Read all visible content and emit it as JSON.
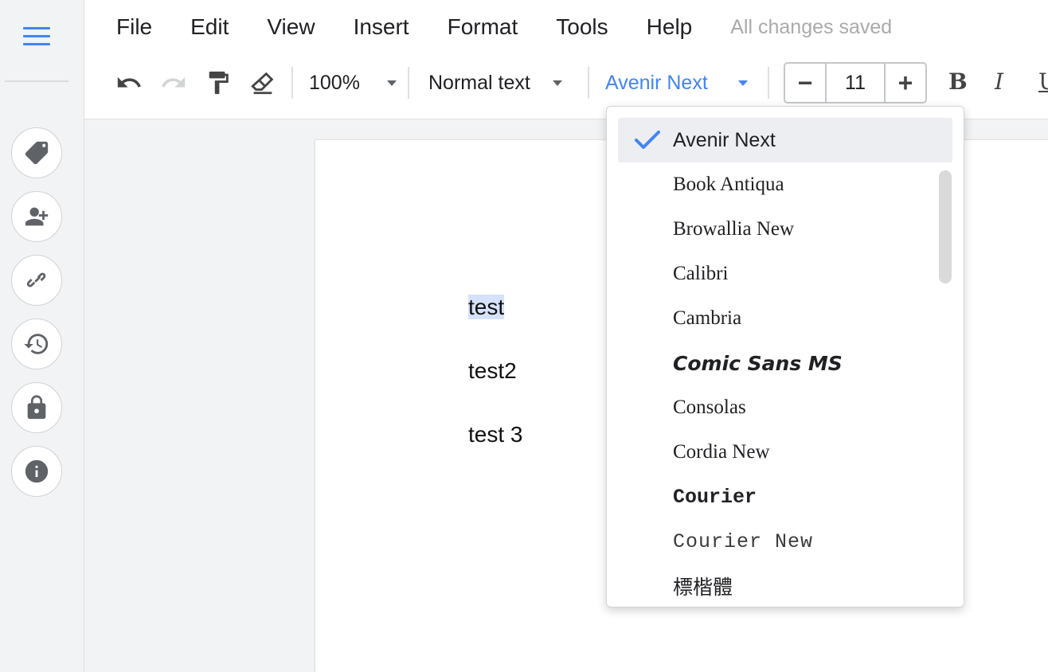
{
  "menubar": {
    "items": [
      "File",
      "Edit",
      "View",
      "Insert",
      "Format",
      "Tools",
      "Help"
    ],
    "status": "All changes saved"
  },
  "toolbar": {
    "zoom": "100%",
    "paragraph_style": "Normal text",
    "font": "Avenir Next",
    "font_size": "11",
    "bold_label": "B",
    "italic_label": "I",
    "underline_label": "U",
    "minus_label": "−",
    "plus_label": "+"
  },
  "document": {
    "paragraphs": [
      "test",
      "test2",
      "test 3"
    ]
  },
  "font_menu": {
    "items": [
      "Avenir Next",
      "Book Antiqua",
      "Browallia New",
      "Calibri",
      "Cambria",
      "Comic Sans MS",
      "Consolas",
      "Cordia New",
      "Courier",
      "Courier New",
      "標楷體"
    ],
    "selected": "Avenir Next"
  },
  "colors": {
    "accent": "#4285f4",
    "selection_highlight": "#d6e2fb",
    "menu_selected_bg": "#eceef1"
  },
  "icons": {
    "rail": [
      "menu-icon",
      "tag-icon",
      "add-person-icon",
      "link-icon",
      "history-icon",
      "lock-icon",
      "info-icon"
    ],
    "toolbar": [
      "undo-icon",
      "redo-icon",
      "paint-format-icon",
      "clear-format-icon"
    ]
  }
}
